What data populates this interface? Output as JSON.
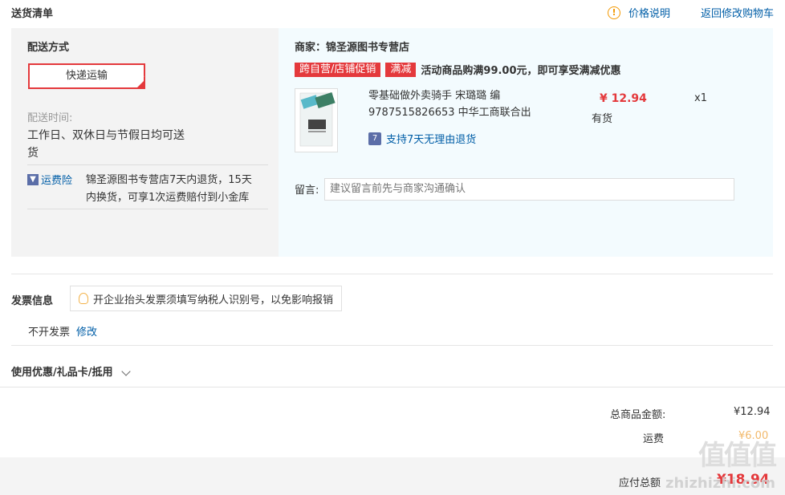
{
  "header": {
    "title": "送货清单",
    "price_info": "价格说明",
    "back_to_cart": "返回修改购物车"
  },
  "delivery": {
    "label": "配送方式",
    "method": "快递运输",
    "time_label": "配送时间:",
    "time_value_line1": "工作日、双休日与节假日均可送",
    "time_value_line2": "货",
    "insurance_label": "运费险",
    "insurance_text_line1": "锦圣源图书专营店7天内退货，15天",
    "insurance_text_line2": "内换货，可享1次运费赔付到小金库"
  },
  "merchant": {
    "label": "商家：锦圣源图书专营店",
    "tag1": "跨自营/店铺促销",
    "tag2": "满减",
    "promo_text": "活动商品购满99.00元，即可享受满减优惠"
  },
  "product": {
    "name_line1": "零基础做外卖骑手 宋璐璐 编",
    "name_line2": "9787515826653 中华工商联合出",
    "price": "¥ 12.94",
    "quantity": "x1",
    "stock": "有货",
    "return_policy": "支持7天无理由退货",
    "return_icon_text": "7"
  },
  "note": {
    "label": "留言:",
    "placeholder": "建议留言前先与商家沟通确认"
  },
  "invoice": {
    "label": "发票信息",
    "tip": "开企业抬头发票须填写纳税人识别号，以免影响报销",
    "status": "不开发票",
    "edit": "修改"
  },
  "coupon": {
    "label": "使用优惠/礼品卡/抵用"
  },
  "summary": {
    "subtotal_label": "总商品金额:",
    "subtotal_value": "¥12.94",
    "shipping_label": "运费",
    "shipping_value": "¥6.00",
    "total_label": "应付总额",
    "total_value": "¥18.94"
  },
  "watermark": {
    "text": "值值值",
    "url": "zhizhizhi.com"
  }
}
